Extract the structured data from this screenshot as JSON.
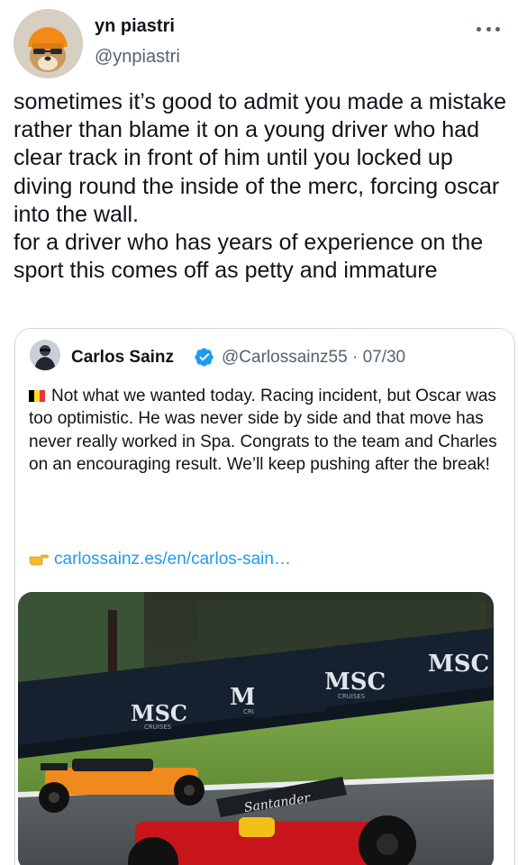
{
  "author": {
    "name": "yn piastri",
    "handle": "@ynpiastri"
  },
  "icons": {
    "more": "more-horizontal-icon",
    "verified": "verified-badge-icon",
    "flag": "belgium-flag-emoji",
    "pointer": "pointing-hand-emoji"
  },
  "tweet": {
    "text": "sometimes it’s good to admit you made a mistake rather than blame it on a young driver who had clear track in front of him until you locked up diving round the inside of the merc, forcing oscar into the wall.\nfor a driver who has years of experience on the sport this comes off as petty and immature"
  },
  "quote": {
    "name": "Carlos Sainz",
    "handle": "@Carlossainz55",
    "separator": "·",
    "date": "07/30",
    "text": "Not what we wanted today. Racing incident, but Oscar was too optimistic. He was never side by side and that move has never really worked in Spa. Congrats to the team and Charles on an encouraging result. We’ll keep pushing after the break!",
    "link": "carlossainz.es/en/carlos-sain…"
  },
  "media": {
    "sponsor_text": "MSC",
    "sponsor_subtext": "CRUISES",
    "car_livery_text": "Santander"
  },
  "colors": {
    "text_primary": "#0f1419",
    "text_secondary": "#536471",
    "link": "#1d9bf0",
    "border": "#cfd9de",
    "verified": "#1d9bf0",
    "flag": [
      "#000000",
      "#fdda24",
      "#ef3340"
    ]
  }
}
